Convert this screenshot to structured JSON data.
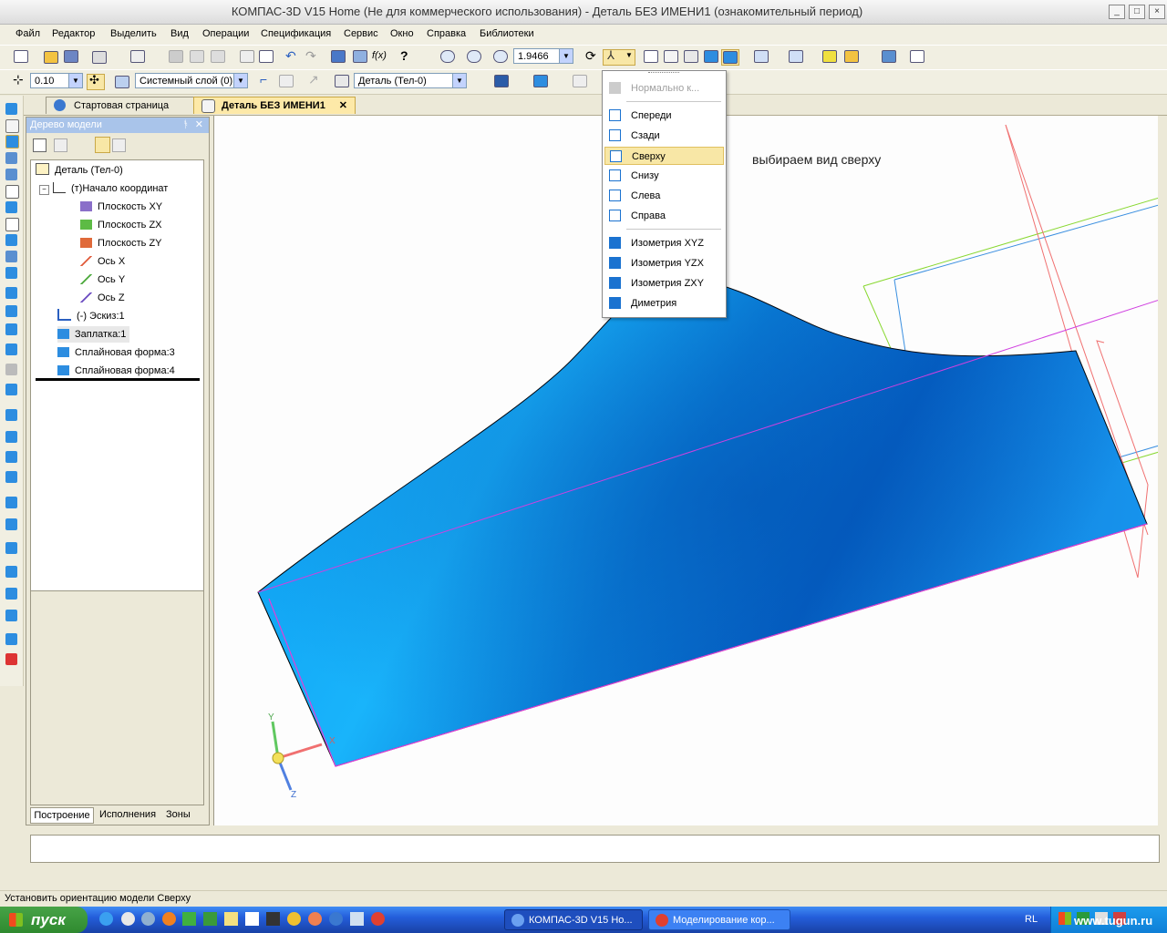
{
  "window": {
    "title": "КОМПАС-3D V15 Home (Не для коммерческого использования) - Деталь БЕЗ ИМЕНИ1 (ознакомительный период)"
  },
  "menu": [
    "Файл",
    "Редактор",
    "Выделить",
    "Вид",
    "Операции",
    "Спецификация",
    "Сервис",
    "Окно",
    "Справка",
    "Библиотеки"
  ],
  "toolbar1": {
    "zoom_value": "1.9466"
  },
  "toolbar2": {
    "step_value": "0.10",
    "layer_value": "Системный слой (0)",
    "state_value": "Деталь (Тел-0)"
  },
  "tabs": [
    {
      "label": "Стартовая страница"
    },
    {
      "label": "Деталь БЕЗ ИМЕНИ1"
    }
  ],
  "tree": {
    "header": "Дерево модели",
    "items": [
      {
        "label": "Деталь (Тел-0)"
      },
      {
        "label": "(т)Начало координат"
      },
      {
        "label": "Плоскость XY"
      },
      {
        "label": "Плоскость ZX"
      },
      {
        "label": "Плоскость ZY"
      },
      {
        "label": "Ось X"
      },
      {
        "label": "Ось Y"
      },
      {
        "label": "Ось Z"
      },
      {
        "label": "(-) Эскиз:1"
      },
      {
        "label": "Заплатка:1"
      },
      {
        "label": "Сплайновая форма:3"
      },
      {
        "label": "Сплайновая форма:4"
      }
    ],
    "bottom_tabs": [
      "Построение",
      "Исполнения",
      "Зоны"
    ]
  },
  "orientation_menu": {
    "disabled_item": "Нормально к...",
    "items": [
      "Спереди",
      "Сзади",
      "Сверху",
      "Снизу",
      "Слева",
      "Справа"
    ],
    "iso_items": [
      "Изометрия XYZ",
      "Изометрия YZX",
      "Изометрия ZXY",
      "Диметрия"
    ],
    "highlighted": "Сверху"
  },
  "viewport": {
    "annotation": "выбираем вид сверху",
    "axis_labels": {
      "x": "X",
      "y": "Y",
      "z": "Z"
    }
  },
  "status": {
    "text": "Установить ориентацию модели Сверху"
  },
  "taskbar": {
    "start_label": "пуск",
    "tasks": [
      "КОМПАС-3D V15 Ho...",
      "Моделирование кор..."
    ],
    "lang": "RL",
    "watermark": "www.tugun.ru"
  },
  "colors": {
    "accent_highlight": "#f8e7a6",
    "model_blue": "#0a8fe8",
    "tree_header": "#a9c4ea",
    "taskbar_blue": "#245edb"
  }
}
